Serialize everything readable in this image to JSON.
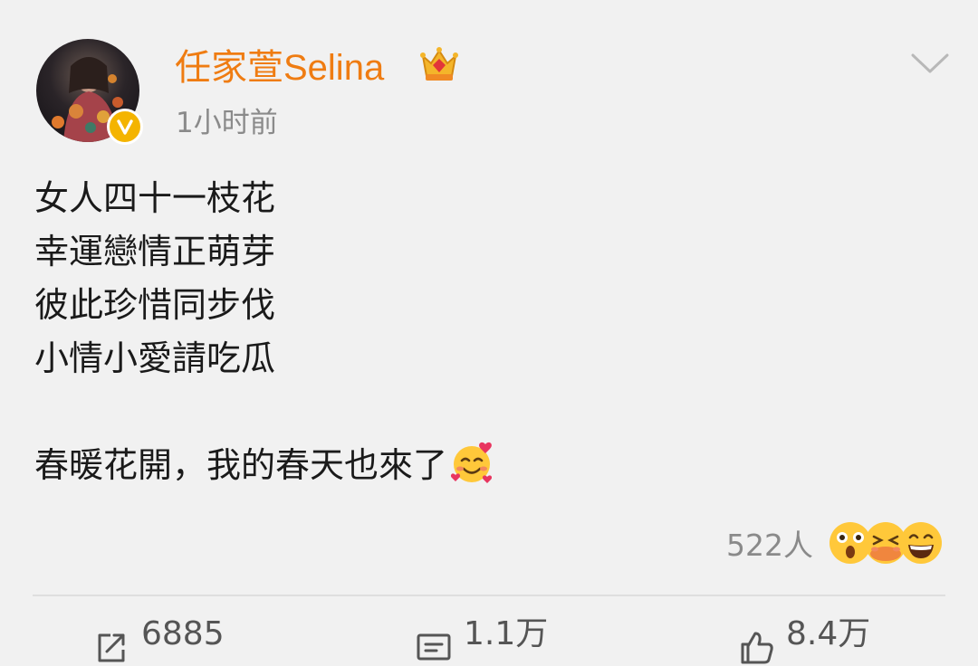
{
  "post": {
    "author": {
      "name": "任家萱Selina",
      "avatar_icon": "avatar-image",
      "verified_icon": "verified-badge-icon",
      "vip_icon": "crown-icon",
      "name_color": "#ef7c12"
    },
    "timestamp": "1小时前",
    "menu_icon": "chevron-down-icon",
    "content_lines": [
      "女人四十一枝花",
      "幸運戀情正萌芽",
      "彼此珍惜同步伐",
      "小情小愛請吃瓜"
    ],
    "content_tail": "春暖花開，我的春天也來了",
    "content_emoji": "smiling-face-with-hearts-emoji",
    "reactions": {
      "count_label": "522人",
      "icons": [
        "surprised-emoji",
        "hug-emoji",
        "grin-emoji"
      ]
    },
    "actions": {
      "repost": {
        "icon": "repost-icon",
        "count": "6885"
      },
      "comment": {
        "icon": "comment-icon",
        "count": "1.1万"
      },
      "like": {
        "icon": "thumbs-up-icon",
        "count": "8.4万"
      }
    }
  }
}
